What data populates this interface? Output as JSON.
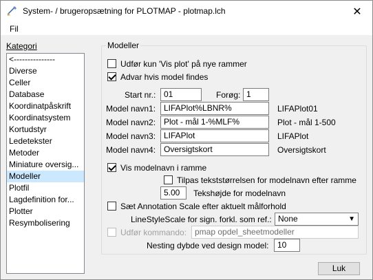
{
  "window": {
    "title": "System- / brugeropsætning for PLOTMAP - plotmap.lch",
    "close_glyph": "✕"
  },
  "menu": {
    "file": "Fil"
  },
  "sidebar": {
    "label": "Kategori",
    "items": [
      {
        "label": "<---------------"
      },
      {
        "label": "Diverse"
      },
      {
        "label": "Celler"
      },
      {
        "label": "Database"
      },
      {
        "label": "Koordinatpåskrift"
      },
      {
        "label": "Koordinatsystem"
      },
      {
        "label": "Kortudstyr"
      },
      {
        "label": "Ledetekster"
      },
      {
        "label": "Metoder"
      },
      {
        "label": "Miniature oversig..."
      },
      {
        "label": "Modeller"
      },
      {
        "label": "Plotfil"
      },
      {
        "label": "Lagdefinition for..."
      },
      {
        "label": "Plotter"
      },
      {
        "label": "Resymbolisering"
      }
    ],
    "selected": "Modeller"
  },
  "group": {
    "title": "Modeller",
    "only_vis_plot": {
      "label": "Udfør kun 'Vis plot' på nye rammer",
      "checked": false
    },
    "warn_model": {
      "label": "Advar hvis model findes",
      "checked": true
    },
    "start_label": "Start nr.:",
    "start_value": "01",
    "increment_label": "Forøg:",
    "increment_value": "1",
    "models": [
      {
        "label": "Model navn1:",
        "value": "LIFAPlot%LBNR%",
        "preview": "LIFAPlot01"
      },
      {
        "label": "Model navn2:",
        "value": "Plot - mål 1-%MLF%",
        "preview": "Plot - mål 1-500"
      },
      {
        "label": "Model navn3:",
        "value": "LIFAPlot",
        "preview": "LIFAPlot"
      },
      {
        "label": "Model navn4:",
        "value": "Oversigtskort",
        "preview": "Oversigtskort"
      }
    ],
    "show_modelname": {
      "label": "Vis modelnavn i ramme",
      "checked": true
    },
    "fit_text": {
      "label": "Tilpas tekststørrelsen for modelnavn efter ramme",
      "checked": false
    },
    "text_height_value": "5.00",
    "text_height_label": "Tekshøjde for modelnavn",
    "annotation_scale": {
      "label": "Sæt Annotation Scale efter aktuelt målforhold",
      "checked": false
    },
    "linestyle_label": "LineStyleScale for sign. forkl. som ref.:",
    "linestyle_value": "None",
    "command": {
      "label": "Udfør kommando:",
      "checked": false,
      "value": "pmap opdel_sheetmodeller"
    },
    "nesting_label": "Nesting dybde ved design model:",
    "nesting_value": "10"
  },
  "footer": {
    "ok_label": "Luk"
  }
}
